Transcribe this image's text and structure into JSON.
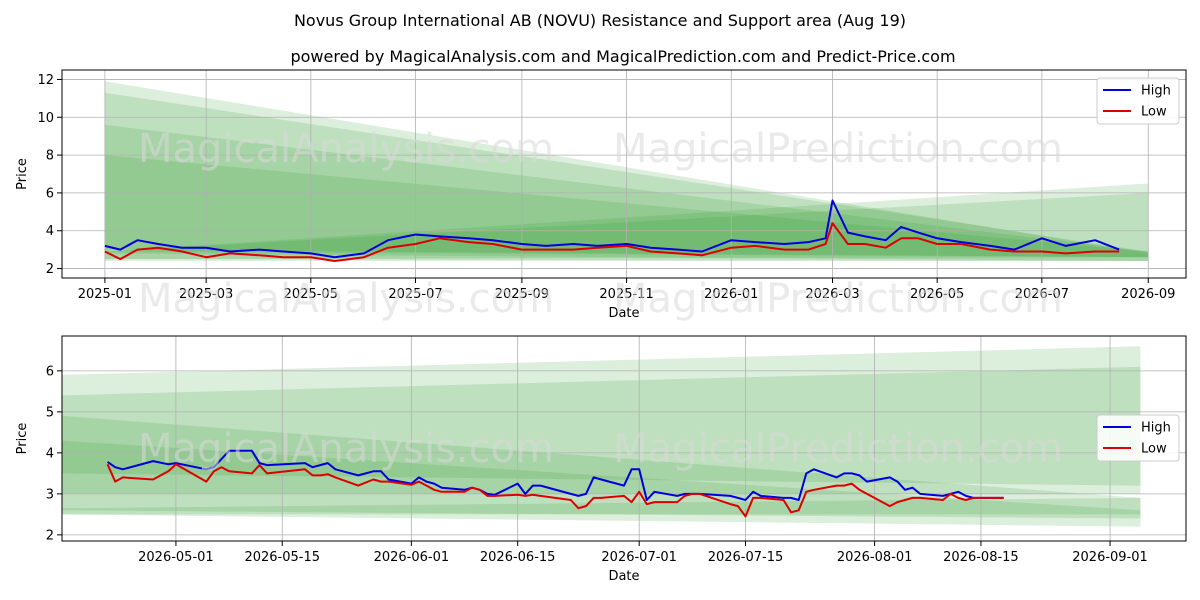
{
  "titles": {
    "main": "Novus Group International AB (NOVU) Resistance and Support area (Aug 19)",
    "sub": "powered by MagicalAnalysis.com and MagicalPrediction.com and Predict-Price.com"
  },
  "watermarks": [
    "MagicalAnalysis.com",
    "MagicalPrediction.com"
  ],
  "colors": {
    "high": "#0000dd",
    "low": "#dd0000",
    "band": "#2e9a2e",
    "grid": "#b0b0b0"
  },
  "chart_data": [
    {
      "type": "line",
      "title": "",
      "xlabel": "Date",
      "ylabel": "Price",
      "xlim": [
        "2024-12-07",
        "2026-09-23"
      ],
      "ylim": [
        1.5,
        12.5
      ],
      "grid": true,
      "legend": "top-right",
      "x_ticks": [
        "2025-01",
        "2025-03",
        "2025-05",
        "2025-07",
        "2025-09",
        "2025-11",
        "2026-01",
        "2026-03",
        "2026-05",
        "2026-07",
        "2026-09"
      ],
      "y_ticks": [
        2,
        4,
        6,
        8,
        10,
        12
      ],
      "series": [
        {
          "name": "High",
          "x": [
            "2025-01-01",
            "2025-01-10",
            "2025-01-20",
            "2025-02-01",
            "2025-02-15",
            "2025-03-01",
            "2025-03-15",
            "2025-04-01",
            "2025-04-15",
            "2025-05-01",
            "2025-05-15",
            "2025-06-01",
            "2025-06-15",
            "2025-07-01",
            "2025-07-15",
            "2025-08-01",
            "2025-08-15",
            "2025-09-01",
            "2025-09-15",
            "2025-10-01",
            "2025-10-15",
            "2025-11-01",
            "2025-11-15",
            "2025-12-01",
            "2025-12-15",
            "2026-01-01",
            "2026-01-15",
            "2026-02-01",
            "2026-02-15",
            "2026-02-25",
            "2026-03-01",
            "2026-03-10",
            "2026-03-20",
            "2026-04-01",
            "2026-04-10",
            "2026-04-20",
            "2026-05-01",
            "2026-05-15",
            "2026-06-01",
            "2026-06-15",
            "2026-07-01",
            "2026-07-15",
            "2026-08-01",
            "2026-08-15"
          ],
          "values": [
            3.2,
            3.0,
            3.5,
            3.3,
            3.1,
            3.1,
            2.9,
            3.0,
            2.9,
            2.8,
            2.6,
            2.8,
            3.5,
            3.8,
            3.7,
            3.6,
            3.5,
            3.3,
            3.2,
            3.3,
            3.2,
            3.3,
            3.1,
            3.0,
            2.9,
            3.5,
            3.4,
            3.3,
            3.4,
            3.6,
            5.6,
            3.9,
            3.7,
            3.5,
            4.2,
            3.9,
            3.6,
            3.4,
            3.2,
            3.0,
            3.6,
            3.2,
            3.5,
            3.0
          ]
        },
        {
          "name": "Low",
          "x": [
            "2025-01-01",
            "2025-01-10",
            "2025-01-20",
            "2025-02-01",
            "2025-02-15",
            "2025-03-01",
            "2025-03-15",
            "2025-04-01",
            "2025-04-15",
            "2025-05-01",
            "2025-05-15",
            "2025-06-01",
            "2025-06-15",
            "2025-07-01",
            "2025-07-15",
            "2025-08-01",
            "2025-08-15",
            "2025-09-01",
            "2025-09-15",
            "2025-10-01",
            "2025-10-15",
            "2025-11-01",
            "2025-11-15",
            "2025-12-01",
            "2025-12-15",
            "2026-01-01",
            "2026-01-15",
            "2026-02-01",
            "2026-02-15",
            "2026-02-25",
            "2026-03-01",
            "2026-03-10",
            "2026-03-20",
            "2026-04-01",
            "2026-04-10",
            "2026-04-20",
            "2026-05-01",
            "2026-05-15",
            "2026-06-01",
            "2026-06-15",
            "2026-07-01",
            "2026-07-15",
            "2026-08-01",
            "2026-08-15"
          ],
          "values": [
            2.9,
            2.5,
            3.0,
            3.1,
            2.9,
            2.6,
            2.8,
            2.7,
            2.6,
            2.6,
            2.4,
            2.6,
            3.1,
            3.3,
            3.6,
            3.4,
            3.3,
            3.0,
            3.0,
            3.0,
            3.1,
            3.2,
            2.9,
            2.8,
            2.7,
            3.1,
            3.2,
            3.0,
            3.0,
            3.3,
            4.4,
            3.3,
            3.3,
            3.1,
            3.6,
            3.6,
            3.3,
            3.3,
            3.0,
            2.9,
            2.9,
            2.8,
            2.9,
            2.9
          ]
        }
      ],
      "bands": [
        {
          "x0": "2025-01-01",
          "top0": 11.9,
          "bot0": 2.8,
          "x1": "2026-09-01",
          "top1": 2.8,
          "bot1": 2.4
        },
        {
          "x0": "2025-01-01",
          "top0": 11.3,
          "bot0": 3.0,
          "x1": "2026-09-01",
          "top1": 2.9,
          "bot1": 2.6
        },
        {
          "x0": "2025-01-01",
          "top0": 9.6,
          "bot0": 2.9,
          "x1": "2026-09-01",
          "top1": 2.9,
          "bot1": 2.6
        },
        {
          "x0": "2025-01-01",
          "top0": 8.0,
          "bot0": 2.5,
          "x1": "2026-09-01",
          "top1": 2.9,
          "bot1": 2.4
        },
        {
          "x0": "2025-01-01",
          "top0": 2.9,
          "bot0": 2.4,
          "x1": "2026-09-01",
          "top1": 6.5,
          "bot1": 2.4
        },
        {
          "x0": "2025-01-01",
          "top0": 2.9,
          "bot0": 2.5,
          "x1": "2026-09-01",
          "top1": 6.0,
          "bot1": 2.6
        }
      ]
    },
    {
      "type": "line",
      "title": "",
      "xlabel": "Date",
      "ylabel": "Price",
      "xlim": [
        "2026-04-16",
        "2026-09-11"
      ],
      "ylim": [
        1.85,
        6.85
      ],
      "grid": true,
      "legend": "center-right",
      "x_ticks": [
        "2026-05-01",
        "2026-05-15",
        "2026-06-01",
        "2026-06-15",
        "2026-07-01",
        "2026-07-15",
        "2026-08-01",
        "2026-08-15",
        "2026-09-01"
      ],
      "y_ticks": [
        2,
        3,
        4,
        5,
        6
      ],
      "series": [
        {
          "name": "High",
          "x": [
            "2026-04-22",
            "2026-04-23",
            "2026-04-24",
            "2026-04-28",
            "2026-04-30",
            "2026-05-01",
            "2026-05-05",
            "2026-05-06",
            "2026-05-07",
            "2026-05-08",
            "2026-05-11",
            "2026-05-12",
            "2026-05-13",
            "2026-05-18",
            "2026-05-19",
            "2026-05-20",
            "2026-05-21",
            "2026-05-22",
            "2026-05-25",
            "2026-05-27",
            "2026-05-28",
            "2026-05-29",
            "2026-06-01",
            "2026-06-02",
            "2026-06-03",
            "2026-06-04",
            "2026-06-05",
            "2026-06-08",
            "2026-06-09",
            "2026-06-10",
            "2026-06-11",
            "2026-06-12",
            "2026-06-15",
            "2026-06-16",
            "2026-06-17",
            "2026-06-18",
            "2026-06-22",
            "2026-06-23",
            "2026-06-24",
            "2026-06-25",
            "2026-06-26",
            "2026-06-29",
            "2026-06-30",
            "2026-07-01",
            "2026-07-02",
            "2026-07-03",
            "2026-07-06",
            "2026-07-07",
            "2026-07-08",
            "2026-07-09",
            "2026-07-13",
            "2026-07-14",
            "2026-07-15",
            "2026-07-16",
            "2026-07-17",
            "2026-07-20",
            "2026-07-21",
            "2026-07-22",
            "2026-07-23",
            "2026-07-24",
            "2026-07-27",
            "2026-07-28",
            "2026-07-29",
            "2026-07-30",
            "2026-07-31",
            "2026-08-03",
            "2026-08-04",
            "2026-08-05",
            "2026-08-06",
            "2026-08-07",
            "2026-08-10",
            "2026-08-11",
            "2026-08-12",
            "2026-08-13",
            "2026-08-14",
            "2026-08-17",
            "2026-08-18"
          ],
          "values": [
            3.78,
            3.65,
            3.6,
            3.8,
            3.72,
            3.75,
            3.6,
            3.65,
            3.85,
            4.05,
            4.05,
            3.75,
            3.7,
            3.75,
            3.65,
            3.7,
            3.75,
            3.6,
            3.45,
            3.55,
            3.55,
            3.35,
            3.25,
            3.4,
            3.3,
            3.25,
            3.15,
            3.1,
            3.15,
            3.1,
            3.0,
            2.98,
            3.25,
            3.0,
            3.2,
            3.2,
            3.0,
            2.95,
            3.0,
            3.4,
            3.35,
            3.2,
            3.6,
            3.6,
            2.85,
            3.05,
            2.95,
            3.0,
            3.0,
            3.0,
            2.95,
            2.9,
            2.85,
            3.05,
            2.95,
            2.9,
            2.9,
            2.85,
            3.5,
            3.6,
            3.4,
            3.5,
            3.5,
            3.45,
            3.3,
            3.4,
            3.3,
            3.1,
            3.15,
            3.0,
            2.95,
            3.0,
            3.05,
            2.95,
            2.9,
            2.9,
            2.9
          ]
        },
        {
          "name": "Low",
          "x": [
            "2026-04-22",
            "2026-04-23",
            "2026-04-24",
            "2026-04-28",
            "2026-04-30",
            "2026-05-01",
            "2026-05-05",
            "2026-05-06",
            "2026-05-07",
            "2026-05-08",
            "2026-05-11",
            "2026-05-12",
            "2026-05-13",
            "2026-05-18",
            "2026-05-19",
            "2026-05-20",
            "2026-05-21",
            "2026-05-22",
            "2026-05-25",
            "2026-05-27",
            "2026-05-28",
            "2026-05-29",
            "2026-06-01",
            "2026-06-02",
            "2026-06-03",
            "2026-06-04",
            "2026-06-05",
            "2026-06-08",
            "2026-06-09",
            "2026-06-10",
            "2026-06-11",
            "2026-06-12",
            "2026-06-15",
            "2026-06-16",
            "2026-06-17",
            "2026-06-18",
            "2026-06-22",
            "2026-06-23",
            "2026-06-24",
            "2026-06-25",
            "2026-06-26",
            "2026-06-29",
            "2026-06-30",
            "2026-07-01",
            "2026-07-02",
            "2026-07-03",
            "2026-07-06",
            "2026-07-07",
            "2026-07-08",
            "2026-07-09",
            "2026-07-13",
            "2026-07-14",
            "2026-07-15",
            "2026-07-16",
            "2026-07-17",
            "2026-07-20",
            "2026-07-21",
            "2026-07-22",
            "2026-07-23",
            "2026-07-24",
            "2026-07-27",
            "2026-07-28",
            "2026-07-29",
            "2026-07-30",
            "2026-07-31",
            "2026-08-03",
            "2026-08-04",
            "2026-08-05",
            "2026-08-06",
            "2026-08-07",
            "2026-08-10",
            "2026-08-11",
            "2026-08-12",
            "2026-08-13",
            "2026-08-14",
            "2026-08-17",
            "2026-08-18"
          ],
          "values": [
            3.72,
            3.3,
            3.4,
            3.35,
            3.55,
            3.72,
            3.3,
            3.55,
            3.65,
            3.55,
            3.5,
            3.7,
            3.5,
            3.6,
            3.45,
            3.45,
            3.48,
            3.4,
            3.2,
            3.35,
            3.3,
            3.3,
            3.22,
            3.3,
            3.2,
            3.1,
            3.05,
            3.05,
            3.15,
            3.1,
            2.95,
            2.95,
            2.98,
            2.95,
            2.98,
            2.95,
            2.85,
            2.65,
            2.7,
            2.9,
            2.9,
            2.95,
            2.8,
            3.05,
            2.75,
            2.8,
            2.8,
            2.95,
            3.0,
            3.0,
            2.75,
            2.7,
            2.45,
            2.9,
            2.9,
            2.85,
            2.55,
            2.6,
            3.05,
            3.1,
            3.2,
            3.2,
            3.25,
            3.1,
            3.0,
            2.7,
            2.8,
            2.85,
            2.9,
            2.9,
            2.85,
            3.0,
            2.9,
            2.85,
            2.9,
            2.9,
            2.9
          ]
        }
      ],
      "bands": [
        {
          "x0": "2026-04-16",
          "top0": 5.9,
          "bot0": 3.0,
          "x1": "2026-09-05",
          "top1": 6.6,
          "bot1": 3.0
        },
        {
          "x0": "2026-04-16",
          "top0": 5.4,
          "bot0": 3.5,
          "x1": "2026-09-05",
          "top1": 6.1,
          "bot1": 3.2
        },
        {
          "x0": "2026-04-16",
          "top0": 4.9,
          "bot0": 2.5,
          "x1": "2026-09-05",
          "top1": 2.9,
          "bot1": 2.2
        },
        {
          "x0": "2026-04-16",
          "top0": 4.3,
          "bot0": 2.6,
          "x1": "2026-09-05",
          "top1": 2.6,
          "bot1": 2.4
        },
        {
          "x0": "2026-04-16",
          "top0": 2.65,
          "bot0": 2.5,
          "x1": "2026-09-05",
          "top1": 2.9,
          "bot1": 2.5
        }
      ]
    }
  ]
}
